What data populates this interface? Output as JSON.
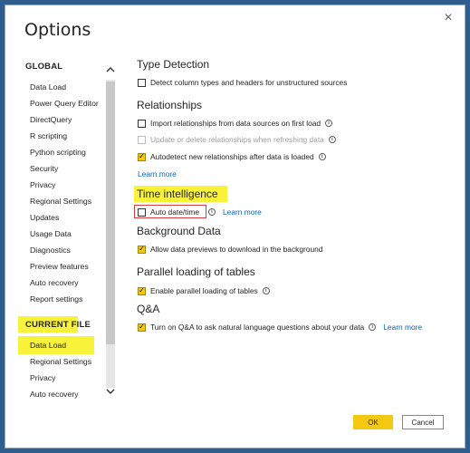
{
  "dialog": {
    "title": "Options",
    "close_icon": "×"
  },
  "sidebar": {
    "global_heading": "GLOBAL",
    "global_items": [
      {
        "label": "Data Load"
      },
      {
        "label": "Power Query Editor"
      },
      {
        "label": "DirectQuery"
      },
      {
        "label": "R scripting"
      },
      {
        "label": "Python scripting"
      },
      {
        "label": "Security"
      },
      {
        "label": "Privacy"
      },
      {
        "label": "Regional Settings"
      },
      {
        "label": "Updates"
      },
      {
        "label": "Usage Data"
      },
      {
        "label": "Diagnostics"
      },
      {
        "label": "Preview features"
      },
      {
        "label": "Auto recovery"
      },
      {
        "label": "Report settings"
      }
    ],
    "current_heading": "CURRENT FILE",
    "current_items": [
      {
        "label": "Data Load",
        "selected": true
      },
      {
        "label": "Regional Settings"
      },
      {
        "label": "Privacy"
      },
      {
        "label": "Auto recovery"
      }
    ],
    "scroll_up": "^",
    "scroll_down": "v"
  },
  "main": {
    "type_detection": {
      "heading": "Type Detection",
      "options": [
        {
          "label": "Detect column types and headers for unstructured sources",
          "checked": false
        }
      ]
    },
    "relationships": {
      "heading": "Relationships",
      "options": [
        {
          "label": "Import relationships from data sources on first load",
          "checked": false,
          "info": true
        },
        {
          "label": "Update or delete relationships when refreshing data",
          "checked": false,
          "disabled": true,
          "info": true
        },
        {
          "label": "Autodetect new relationships after data is loaded",
          "checked": true,
          "info": true
        }
      ],
      "learn_more": "Learn more"
    },
    "time_intelligence": {
      "heading": "Time intelligence",
      "option": {
        "label": "Auto date/time",
        "checked": false,
        "info": true
      },
      "learn_more": "Learn more"
    },
    "background_data": {
      "heading": "Background Data",
      "options": [
        {
          "label": "Allow data previews to download in the background",
          "checked": true
        }
      ]
    },
    "parallel_loading": {
      "heading": "Parallel loading of tables",
      "options": [
        {
          "label": "Enable parallel loading of tables",
          "checked": true,
          "info": true
        }
      ]
    },
    "qna": {
      "heading": "Q&A",
      "options": [
        {
          "label": "Turn on Q&A to ask natural language questions about your data",
          "checked": true,
          "info": true
        }
      ],
      "learn_more": "Learn more"
    }
  },
  "footer": {
    "ok_label": "OK",
    "cancel_label": "Cancel"
  },
  "colors": {
    "highlight": "#f9f23a",
    "accent": "#f2c811",
    "link": "#0b64b8",
    "annotation_box": "#d83b3b"
  }
}
